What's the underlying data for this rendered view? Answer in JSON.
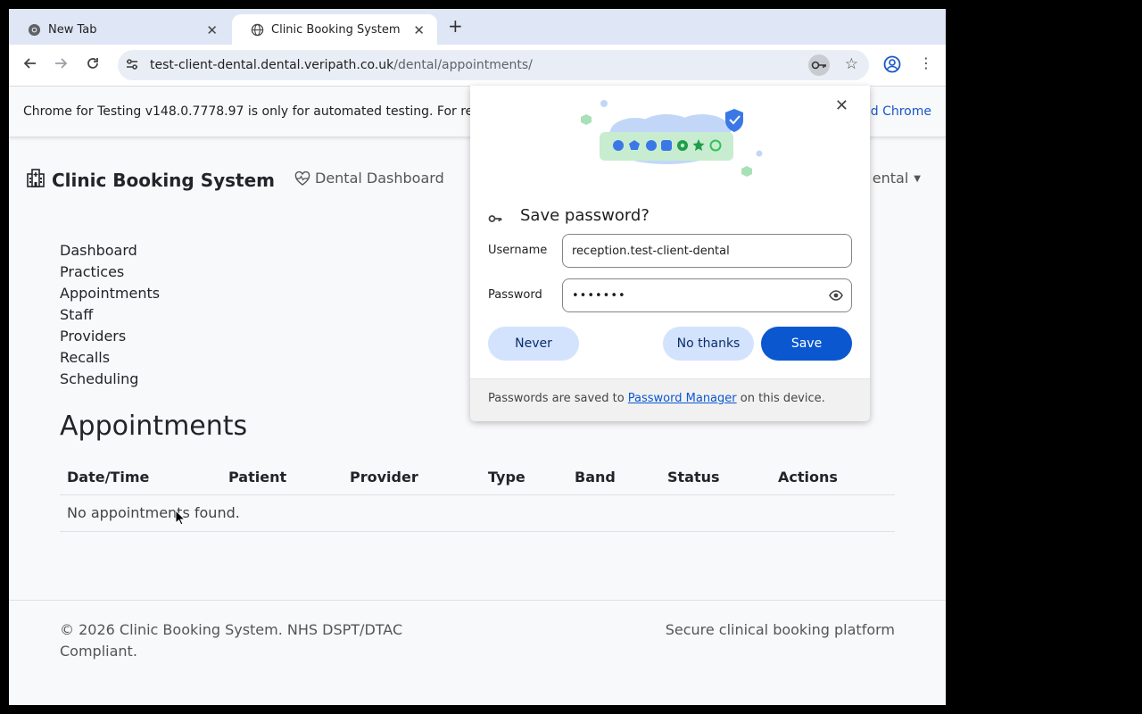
{
  "browser": {
    "tabs": [
      {
        "title": "New Tab",
        "close": "✕"
      },
      {
        "title": "Clinic Booking System",
        "close": "✕"
      }
    ],
    "new_tab": "+",
    "url_host": "test-client-dental.dental.veripath.co.uk",
    "url_path": "/dental/appointments/",
    "infobar_text": "Chrome for Testing v148.0.7778.97 is only for automated testing. For re",
    "infobar_link": "d Chrome"
  },
  "page": {
    "brand": "Clinic Booking System",
    "dashboard_link": "Dental Dashboard",
    "user_menu": "ental",
    "nav": [
      "Dashboard",
      "Practices",
      "Appointments",
      "Staff",
      "Providers",
      "Recalls",
      "Scheduling"
    ],
    "title": "Appointments",
    "table": {
      "columns": [
        "Date/Time",
        "Patient",
        "Provider",
        "Type",
        "Band",
        "Status",
        "Actions"
      ],
      "empty_message": "No appointments found."
    },
    "footer_left": "© 2026 Clinic Booking System. NHS DSPT/DTAC Compliant.",
    "footer_right": "Secure clinical booking platform"
  },
  "password_dialog": {
    "title": "Save password?",
    "username_label": "Username",
    "username_value": "reception.test-client-dental",
    "password_label": "Password",
    "password_masked": "•••••••",
    "never": "Never",
    "no_thanks": "No thanks",
    "save": "Save",
    "footer_pre": "Passwords are saved to ",
    "footer_link": "Password Manager",
    "footer_post": " on this device.",
    "close": "✕"
  },
  "colors": {
    "accent": "#0b57d0",
    "tonal_button": "#d3e3fd",
    "tab_strip": "#dfe6f5"
  },
  "icons": [
    "chrome-icon",
    "globe-icon",
    "back-icon",
    "forward-icon",
    "reload-icon",
    "tune-icon",
    "key-icon",
    "star-icon",
    "profile-icon",
    "menu-icon",
    "hospital-icon",
    "heart-pulse-icon",
    "caret-down-icon",
    "eye-icon",
    "close-icon",
    "cursor-icon"
  ]
}
